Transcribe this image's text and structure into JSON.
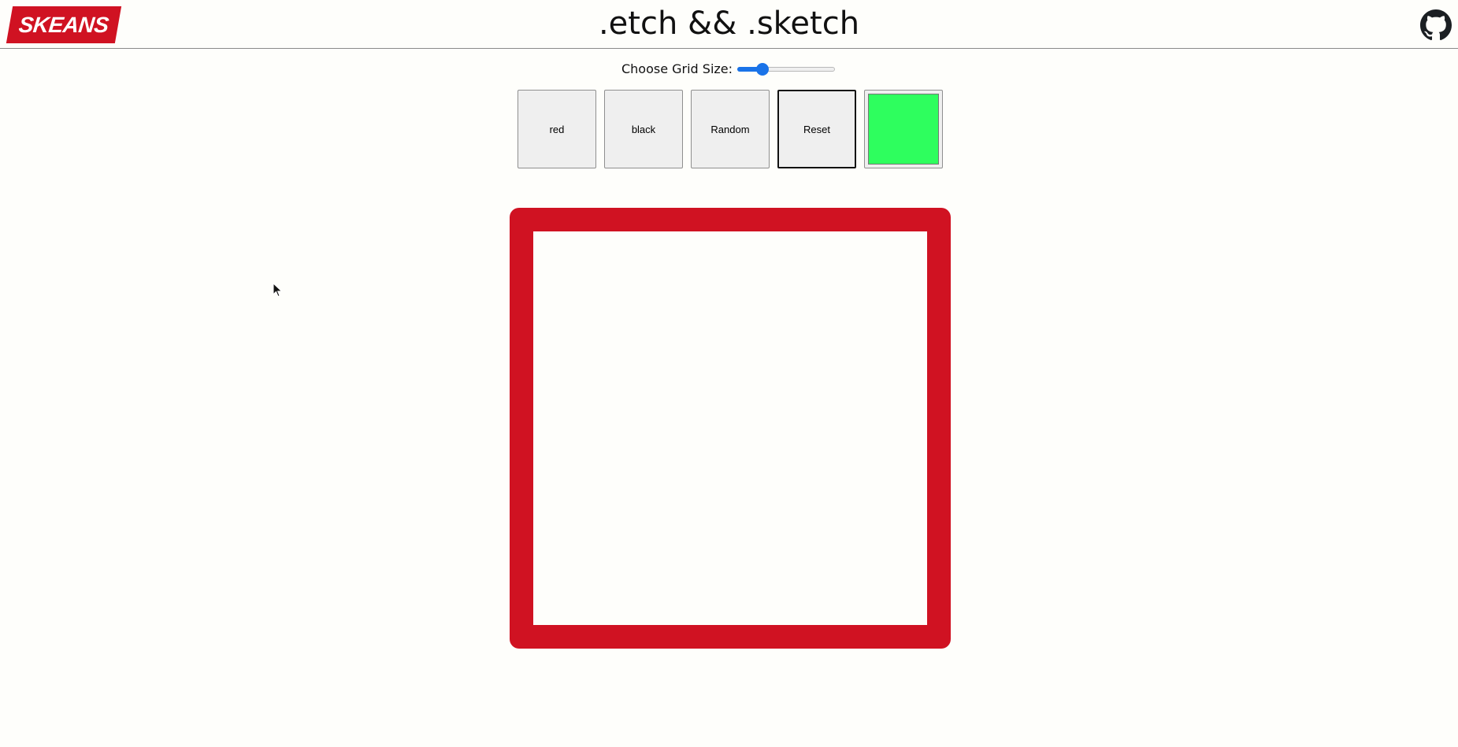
{
  "header": {
    "logo_text": "SKEANS",
    "title": ".etch && .sketch",
    "github_icon": "github-icon"
  },
  "controls": {
    "slider_label": "Choose Grid Size:",
    "slider_value_fraction": 0.22
  },
  "buttons": {
    "red_label": "red",
    "black_label": "black",
    "random_label": "Random",
    "reset_label": "Reset"
  },
  "colors": {
    "brand_red": "#d01222",
    "picker_color": "#2efe5e",
    "slider_accent": "#1a73e8",
    "canvas_bg": "#fefefb"
  }
}
